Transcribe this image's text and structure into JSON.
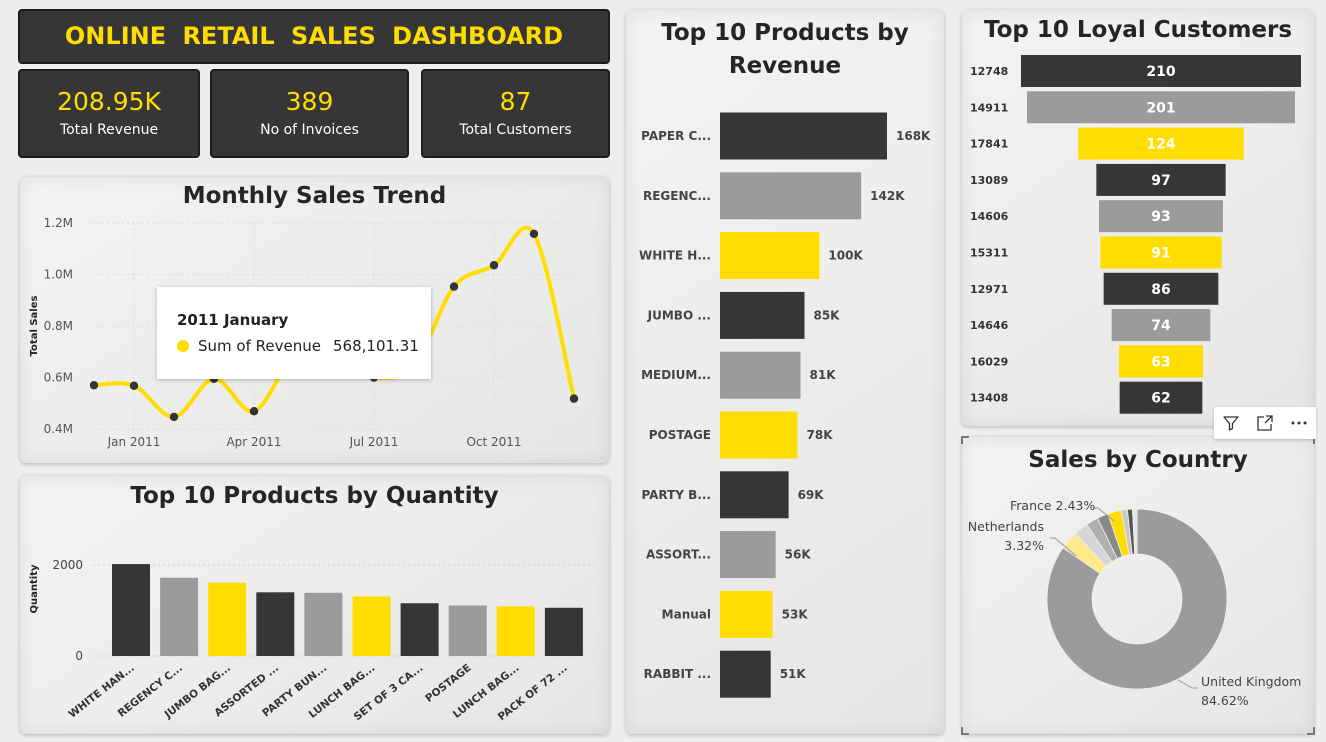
{
  "dashboard": {
    "title": "ONLINE  RETAIL  SALES  DASHBOARD",
    "accent": "#ffdd00",
    "dark": "#363636",
    "grey": "#9b9b9b"
  },
  "kpis": [
    {
      "value": "208.95K",
      "label": "Total Revenue"
    },
    {
      "value": "389",
      "label": "No of Invoices"
    },
    {
      "value": "87",
      "label": "Total Customers"
    }
  ],
  "panels": {
    "monthly_title": "Monthly Sales Trend",
    "quantity_title": "Top 10 Products by Quantity",
    "revenue_title_1": "Top 10 Products by",
    "revenue_title_2": "Revenue",
    "customers_title": "Top 10 Loyal Customers",
    "country_title": "Sales by Country"
  },
  "tooltip": {
    "title": "2011 January",
    "label": "Sum of Revenue",
    "value": "568,101.31"
  },
  "toolbar": {
    "filter_icon": "filter-icon",
    "focus_icon": "focus-mode-icon",
    "more_icon": "more-options-icon"
  },
  "chart_data": [
    {
      "id": "monthly",
      "type": "line",
      "title": "Monthly Sales Trend",
      "ylabel": "Total Sales",
      "xlabel": "",
      "ylim": [
        0.4,
        1.2
      ],
      "y_unit": "M",
      "yticks": [
        0.4,
        0.6,
        0.8,
        1.0,
        1.2
      ],
      "ytick_labels": [
        "0.4M",
        "0.6M",
        "0.8M",
        "1.0M",
        "1.2M"
      ],
      "xtick_labels": [
        {
          "month": 1,
          "label": "Jan 2011"
        },
        {
          "month": 4,
          "label": "Apr 2011"
        },
        {
          "month": 7,
          "label": "Jul 2011"
        },
        {
          "month": 10,
          "label": "Oct 2011"
        }
      ],
      "x": [
        "2010-12",
        "2011-01",
        "2011-02",
        "2011-03",
        "2011-04",
        "2011-05",
        "2011-06",
        "2011-07",
        "2011-08",
        "2011-09",
        "2011-10",
        "2011-11",
        "2011-12"
      ],
      "values": [
        0.57,
        0.568,
        0.447,
        0.595,
        0.469,
        0.679,
        0.662,
        0.6,
        0.646,
        0.953,
        1.036,
        1.158,
        0.518
      ],
      "grid": true,
      "color": "#ffdd00"
    },
    {
      "id": "quantity",
      "type": "bar",
      "title": "Top 10 Products by Quantity",
      "ylabel": "Quantity",
      "ylim": [
        0,
        2400
      ],
      "yticks": [
        0,
        2000
      ],
      "categories": [
        "WHITE HAN...",
        "REGENCY C...",
        "JUMBO BAG...",
        "ASSORTED ...",
        "PARTY BUN...",
        "LUNCH BAG...",
        "SET OF 3 CA...",
        "POSTAGE",
        "LUNCH BAG...",
        "PACK OF 72 ..."
      ],
      "values": [
        2020,
        1720,
        1610,
        1400,
        1390,
        1310,
        1160,
        1110,
        1090,
        1060
      ],
      "colors": [
        "#363636",
        "#9b9b9b",
        "#ffdd00",
        "#363636",
        "#9b9b9b",
        "#ffdd00",
        "#363636",
        "#9b9b9b",
        "#ffdd00",
        "#363636"
      ]
    },
    {
      "id": "revenue",
      "type": "bar",
      "orientation": "horizontal",
      "title": "Top 10 Products by Revenue",
      "categories": [
        "PAPER C...",
        "REGENC...",
        "WHITE H...",
        "JUMBO ...",
        "MEDIUM...",
        "POSTAGE",
        "PARTY B...",
        "ASSORT...",
        "Manual",
        "RABBIT ..."
      ],
      "values": [
        168,
        142,
        100,
        85,
        81,
        78,
        69,
        56,
        53,
        51
      ],
      "labels": [
        "168K",
        "142K",
        "100K",
        "85K",
        "81K",
        "78K",
        "69K",
        "56K",
        "53K",
        "51K"
      ],
      "colors": [
        "#363636",
        "#9b9b9b",
        "#ffdd00",
        "#363636",
        "#9b9b9b",
        "#ffdd00",
        "#363636",
        "#9b9b9b",
        "#ffdd00",
        "#363636"
      ]
    },
    {
      "id": "customers",
      "type": "bar",
      "orientation": "funnel",
      "title": "Top 10 Loyal Customers",
      "categories": [
        "12748",
        "14911",
        "17841",
        "13089",
        "14606",
        "15311",
        "12971",
        "14646",
        "16029",
        "13408"
      ],
      "values": [
        210,
        201,
        124,
        97,
        93,
        91,
        86,
        74,
        63,
        62
      ],
      "colors": [
        "#363636",
        "#9b9b9b",
        "#ffdd00",
        "#363636",
        "#9b9b9b",
        "#ffdd00",
        "#363636",
        "#9b9b9b",
        "#ffdd00",
        "#363636"
      ]
    },
    {
      "id": "country",
      "type": "pie",
      "variant": "donut",
      "title": "Sales by Country",
      "slices": [
        {
          "name": "United Kingdom",
          "value": 84.62,
          "label": "United Kingdom",
          "pct": "84.62%",
          "color": "#9b9b9b"
        },
        {
          "name": "Netherlands",
          "value": 3.32,
          "label": "Netherlands",
          "pct": "3.32%",
          "color": "#ffe98a"
        },
        {
          "name": "s3",
          "value": 2.6,
          "color": "#d6d6d6"
        },
        {
          "name": "s4",
          "value": 2.2,
          "color": "#b0b0b0"
        },
        {
          "name": "s5",
          "value": 2.0,
          "color": "#8a8a8a"
        },
        {
          "name": "France",
          "value": 2.43,
          "label": "France",
          "pct": "2.43%",
          "color": "#ffdd00"
        },
        {
          "name": "s7",
          "value": 1.1,
          "color": "#c8c8c8"
        },
        {
          "name": "s8",
          "value": 0.9,
          "color": "#555555"
        },
        {
          "name": "s9",
          "value": 0.8,
          "color": "#e6e6e6"
        }
      ]
    }
  ]
}
